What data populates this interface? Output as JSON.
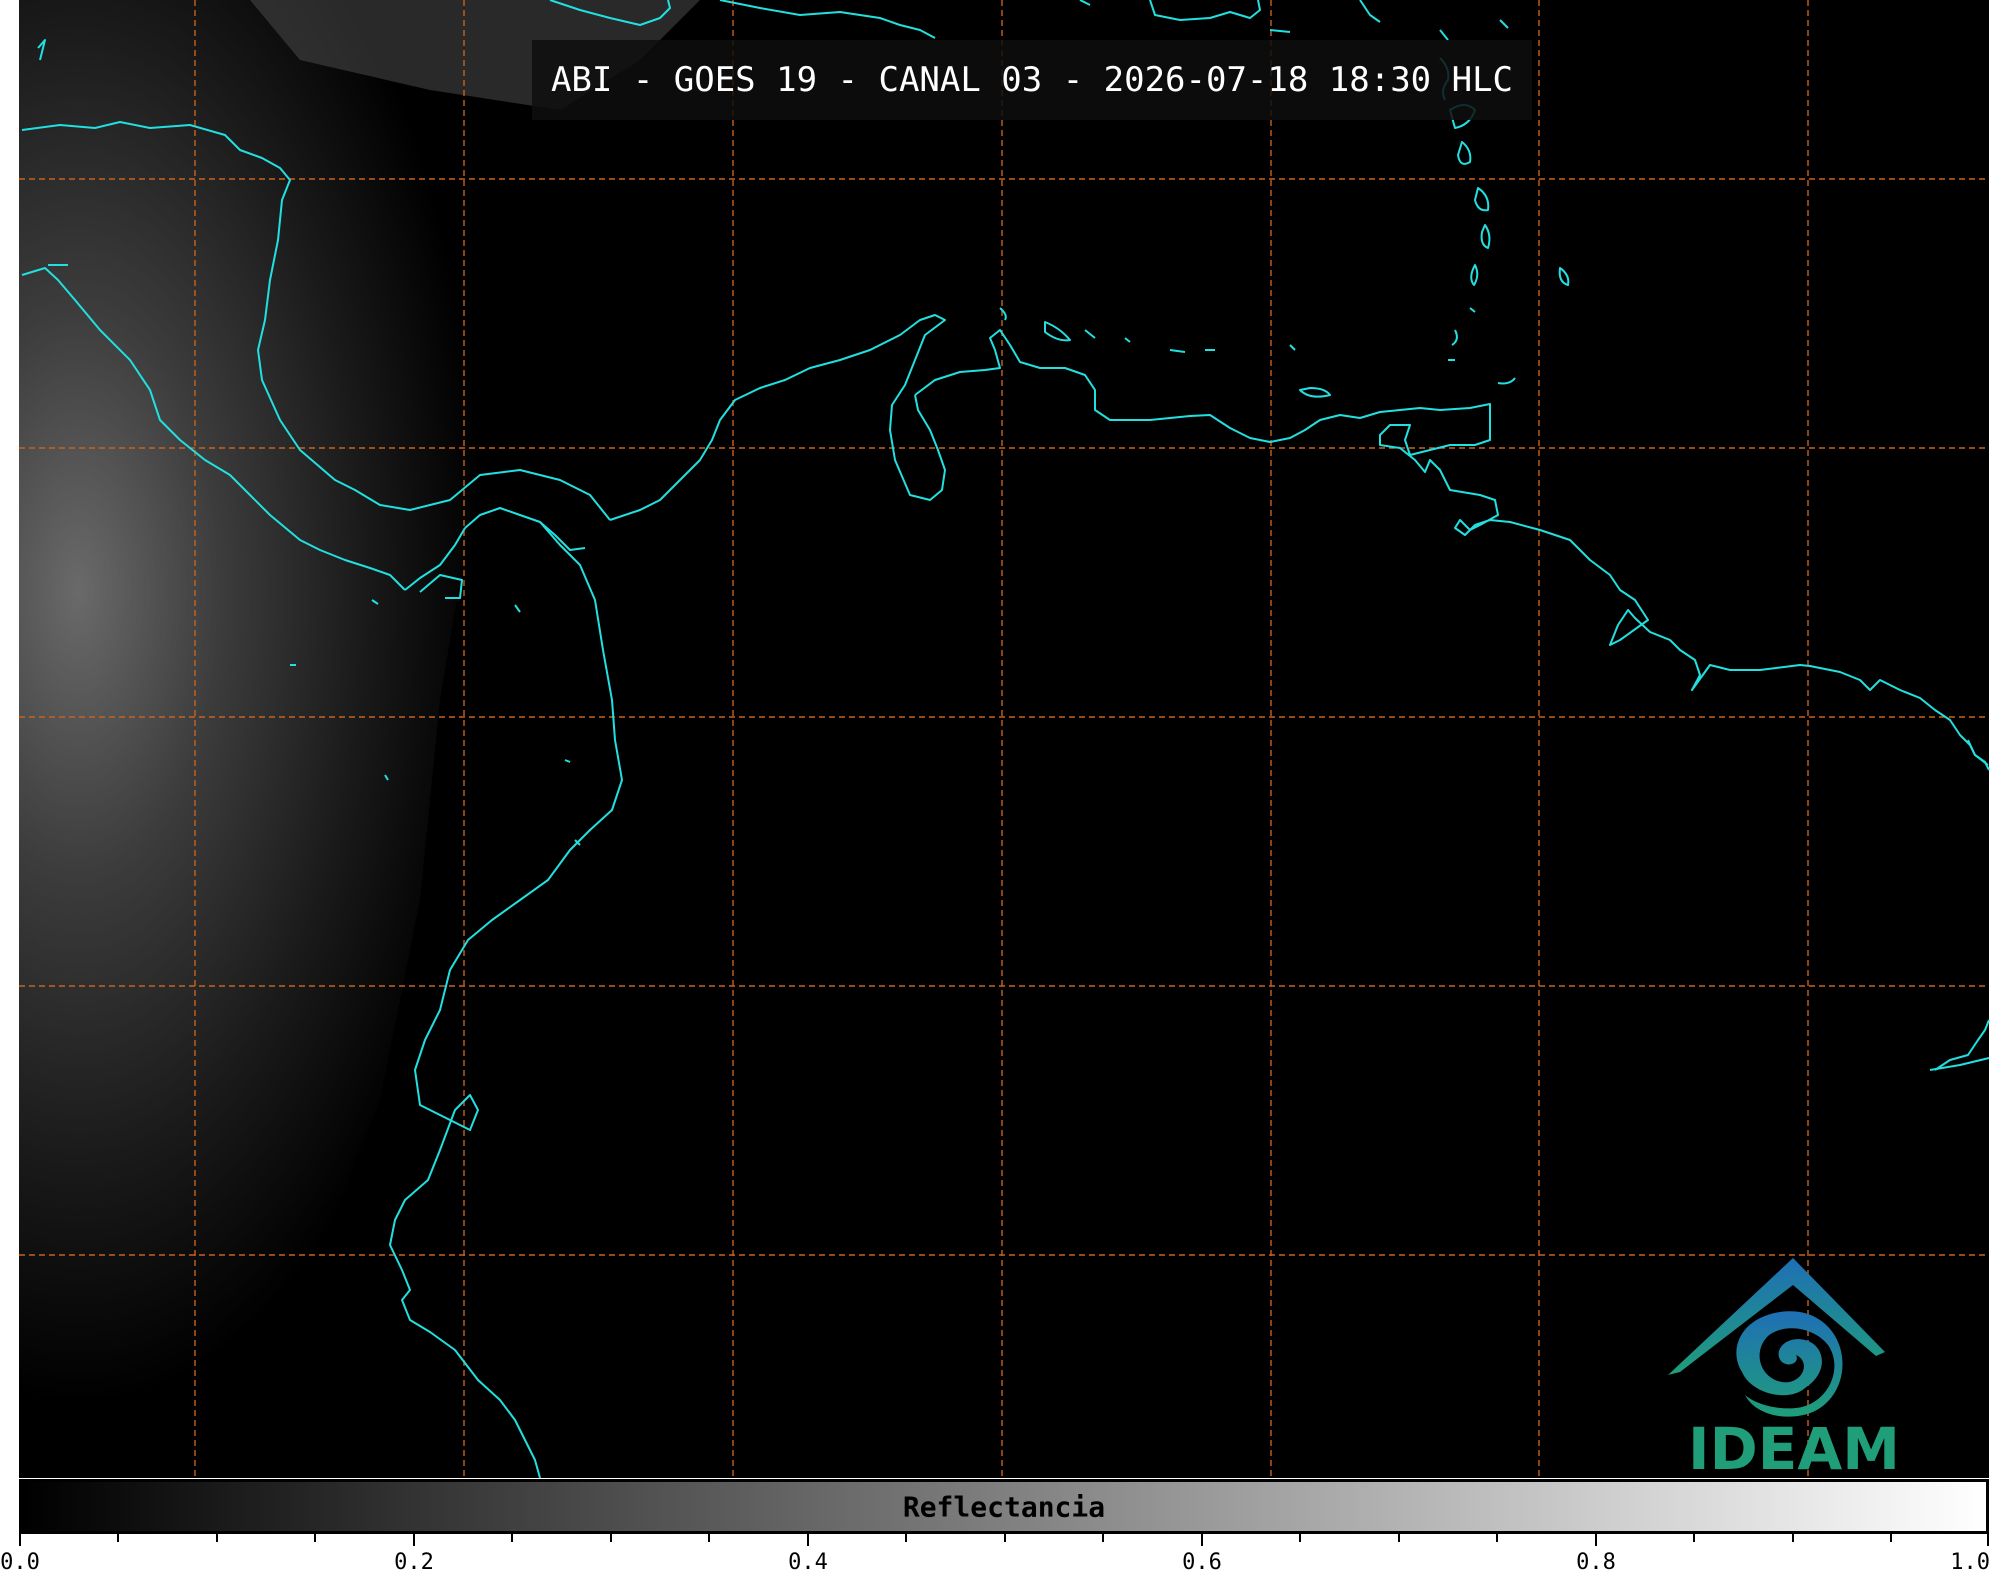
{
  "title": "ABI - GOES 19 - CANAL 03 - 2026-07-18 18:30 HLC",
  "colors": {
    "background": "#000000",
    "coastline": "#22e0e0",
    "gridline": "#c8621e",
    "logo_dark": "#1f6fb5",
    "logo_green": "#1f9e79"
  },
  "colorbar": {
    "label": "Reflectancia",
    "tick_labels": [
      "0.0",
      "0.2",
      "0.4",
      "0.6",
      "0.8",
      "1.0"
    ],
    "min": 0.0,
    "max": 1.0,
    "colormap": "grayscale"
  },
  "logo": {
    "text": "IDEAM",
    "icon": "ideam-logo-icon"
  }
}
